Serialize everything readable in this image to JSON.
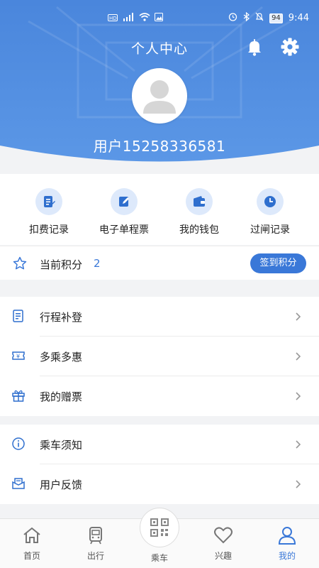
{
  "status_bar": {
    "left_icons": [
      "hd-icon",
      "signal-icon",
      "wifi-icon",
      "image-icon"
    ],
    "battery": "94",
    "time": "9:44"
  },
  "header": {
    "title": "个人中心",
    "username": "用户15258336581"
  },
  "quick_actions": [
    {
      "label": "扣费记录",
      "icon": "receipt-icon"
    },
    {
      "label": "电子单程票",
      "icon": "ticket-edit-icon"
    },
    {
      "label": "我的钱包",
      "icon": "wallet-icon"
    },
    {
      "label": "过闸记录",
      "icon": "clock-icon"
    }
  ],
  "points": {
    "label": "当前积分",
    "value": "2",
    "button": "签到积分"
  },
  "menu_group_1": [
    {
      "label": "行程补登",
      "icon": "trip-register-icon"
    },
    {
      "label": "多乘多惠",
      "icon": "discount-ticket-icon"
    },
    {
      "label": "我的赠票",
      "icon": "gift-icon"
    }
  ],
  "menu_group_2": [
    {
      "label": "乘车须知",
      "icon": "info-icon"
    },
    {
      "label": "用户反馈",
      "icon": "feedback-icon"
    }
  ],
  "bottom_nav": [
    {
      "label": "首页",
      "icon": "home-icon"
    },
    {
      "label": "出行",
      "icon": "metro-icon"
    },
    {
      "label": "乘车",
      "icon": "qr-code-icon"
    },
    {
      "label": "兴趣",
      "icon": "heart-icon"
    },
    {
      "label": "我的",
      "icon": "user-icon",
      "active": true
    }
  ],
  "colors": {
    "primary": "#3a78d8",
    "header_top": "#4f8de0",
    "icon_bg": "#dde9fb",
    "icon_blue": "#2f6fce"
  }
}
